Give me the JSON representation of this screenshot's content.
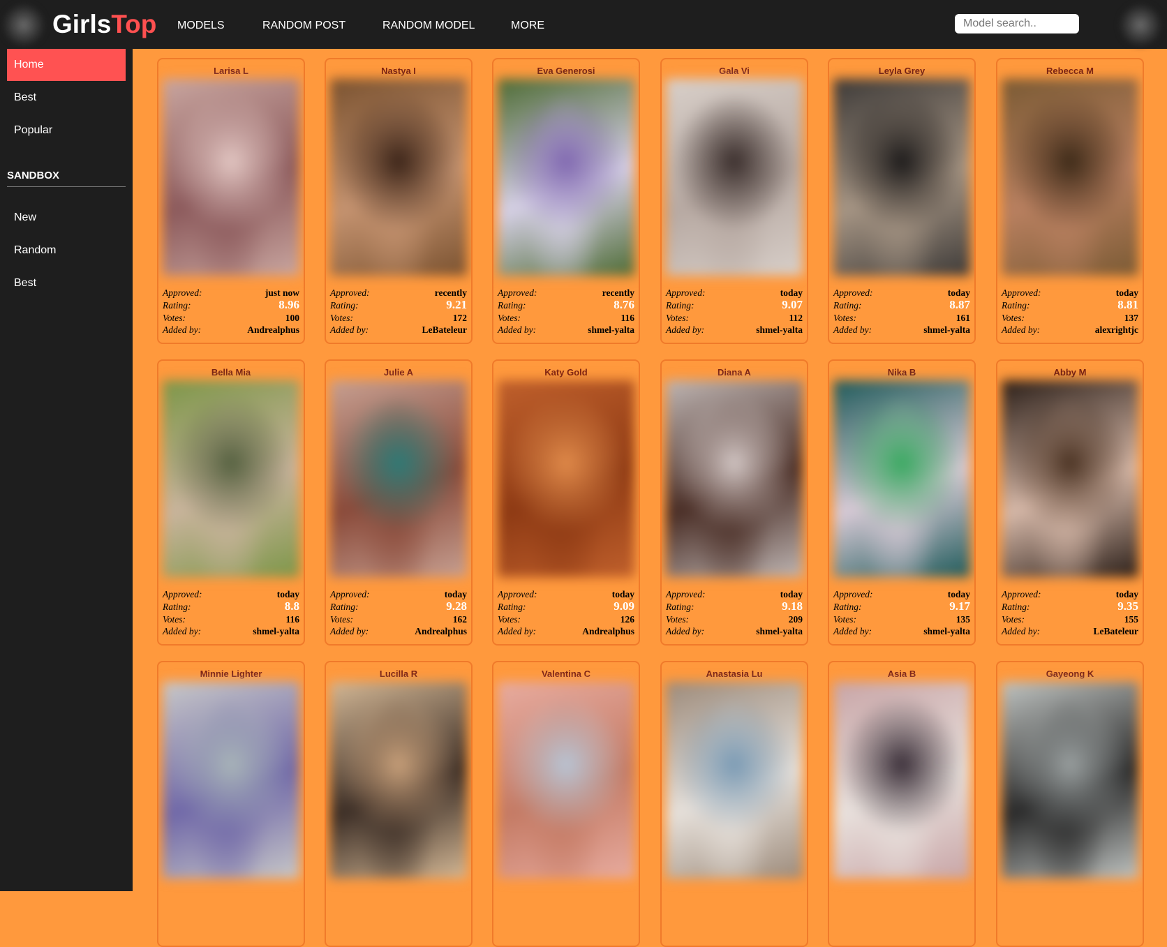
{
  "header": {
    "logo_part1": "Girls",
    "logo_part2": "Top",
    "nav": [
      "MODELS",
      "RANDOM POST",
      "RANDOM MODEL",
      "MORE"
    ],
    "search_placeholder": "Model search.."
  },
  "sidebar": {
    "items": [
      "Home",
      "Best",
      "Popular"
    ],
    "section_title": "SANDBOX",
    "sandbox_items": [
      "New",
      "Random",
      "Best"
    ]
  },
  "labels": {
    "approved": "Approved:",
    "rating": "Rating:",
    "votes": "Votes:",
    "added_by": "Added by:"
  },
  "colors": {
    "accent": "#ff5050",
    "content_bg": "#ff993d",
    "bar_bg": "#1e1e1e",
    "model_name": "#7a1f10"
  },
  "cards": [
    {
      "name": "Larisa L",
      "approved": "just now",
      "rating": "8.96",
      "votes": "100",
      "added_by": "Andrealphus",
      "photo": [
        "#c9a6a0",
        "#8c5a5c",
        "#e2c6c2"
      ]
    },
    {
      "name": "Nastya I",
      "approved": "recently",
      "rating": "9.21",
      "votes": "172",
      "added_by": "LeBateleur",
      "photo": [
        "#7a5230",
        "#c59370",
        "#3b2418"
      ]
    },
    {
      "name": "Eva Generosi",
      "approved": "recently",
      "rating": "8.76",
      "votes": "116",
      "added_by": "shmel-yalta",
      "photo": [
        "#4d6b34",
        "#d6d0e6",
        "#8068b0"
      ]
    },
    {
      "name": "Gala Vi",
      "approved": "today",
      "rating": "9.07",
      "votes": "112",
      "added_by": "shmel-yalta",
      "photo": [
        "#d8cfc9",
        "#b7a9a2",
        "#3a2e2c"
      ]
    },
    {
      "name": "Leyla Grey",
      "approved": "today",
      "rating": "8.87",
      "votes": "161",
      "added_by": "shmel-yalta",
      "photo": [
        "#3d3a38",
        "#a69584",
        "#1c1a1a"
      ]
    },
    {
      "name": "Rebecca M",
      "approved": "today",
      "rating": "8.81",
      "votes": "137",
      "added_by": "alexrightjc",
      "photo": [
        "#7a5a34",
        "#b98060",
        "#3d2a18"
      ]
    },
    {
      "name": "Bella Mia",
      "approved": "today",
      "rating": "8.8",
      "votes": "116",
      "added_by": "shmel-yalta",
      "photo": [
        "#7c9648",
        "#c9b49c",
        "#556140"
      ]
    },
    {
      "name": "Julie A",
      "approved": "today",
      "rating": "9.28",
      "votes": "162",
      "added_by": "Andrealphus",
      "photo": [
        "#c7a092",
        "#8a4a3a",
        "#2e7a76"
      ]
    },
    {
      "name": "Katy Gold",
      "approved": "today",
      "rating": "9.09",
      "votes": "126",
      "added_by": "Andrealphus",
      "photo": [
        "#c0602c",
        "#8e3a14",
        "#e08a4a"
      ]
    },
    {
      "name": "Diana A",
      "approved": "today",
      "rating": "9.18",
      "votes": "209",
      "added_by": "shmel-yalta",
      "photo": [
        "#bfb6b4",
        "#4a2e26",
        "#d2c6c4"
      ]
    },
    {
      "name": "Nika B",
      "approved": "today",
      "rating": "9.17",
      "votes": "135",
      "added_by": "shmel-yalta",
      "photo": [
        "#1e5a5a",
        "#d8cad6",
        "#38a860"
      ]
    },
    {
      "name": "Abby M",
      "approved": "today",
      "rating": "9.35",
      "votes": "155",
      "added_by": "LeBateleur",
      "photo": [
        "#2a1e18",
        "#d6b8a8",
        "#4a3222"
      ]
    },
    {
      "name": "Minnie Lighter",
      "photo": [
        "#c8c8c8",
        "#7068a8",
        "#a8b4b8"
      ]
    },
    {
      "name": "Lucilla R",
      "photo": [
        "#d4b896",
        "#3c2e26",
        "#c8a07a"
      ]
    },
    {
      "name": "Valentina C",
      "photo": [
        "#e8aca0",
        "#c47a64",
        "#b8c4d4"
      ]
    },
    {
      "name": "Anastasia Lu",
      "photo": [
        "#9c8a7a",
        "#e6e0da",
        "#7a9ab4"
      ]
    },
    {
      "name": "Asia B",
      "photo": [
        "#c8a4a6",
        "#e8e0dc",
        "#3a2e38"
      ]
    },
    {
      "name": "Gayeong K",
      "photo": [
        "#c0c4c2",
        "#2a2a2a",
        "#9aa0a0"
      ]
    }
  ]
}
